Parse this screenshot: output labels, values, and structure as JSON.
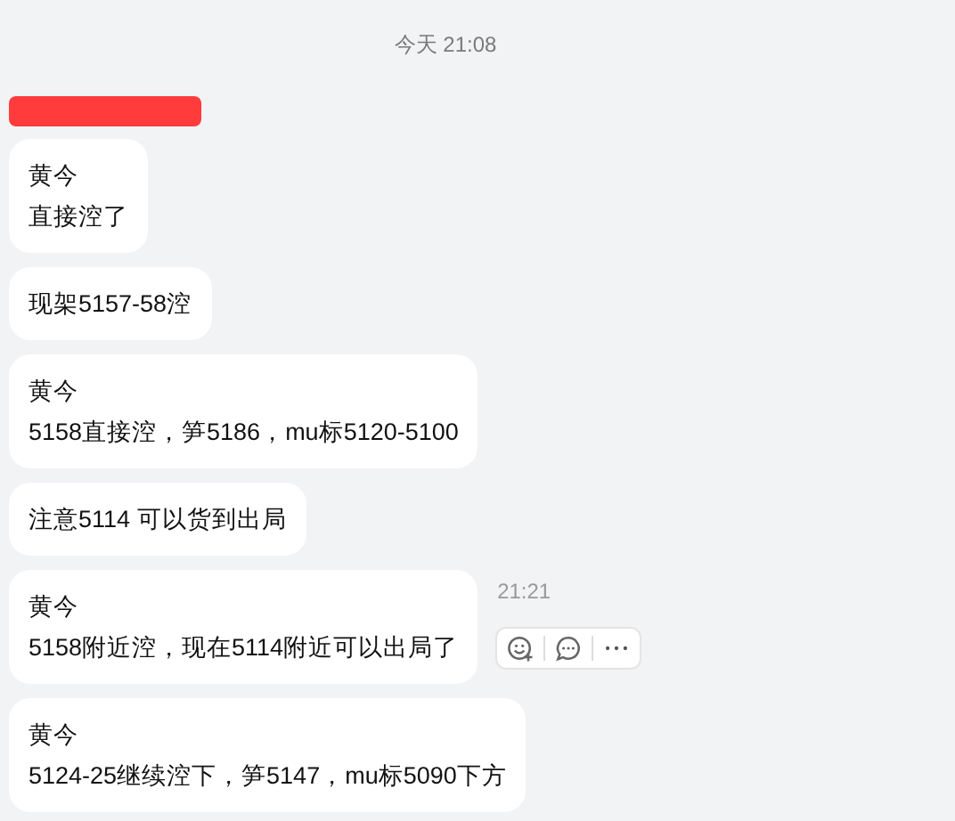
{
  "date_divider": "今天 21:08",
  "messages": [
    {
      "lines": [
        "黄今",
        "直接涳了"
      ],
      "redacted_sender": true
    },
    {
      "lines": [
        "现架5157-58涳"
      ]
    },
    {
      "lines": [
        "黄今",
        "5158直接涳，笋5186，mu标5120-5100"
      ]
    },
    {
      "lines": [
        "注意5114 可以货到出局"
      ]
    },
    {
      "lines": [
        "黄今",
        "5158附近涳，现在5114附近可以出局了"
      ],
      "time": "21:21",
      "hovered": true
    },
    {
      "lines": [
        "黄今",
        "5124-25继续涳下，笋5147，mu标5090下方"
      ]
    }
  ]
}
